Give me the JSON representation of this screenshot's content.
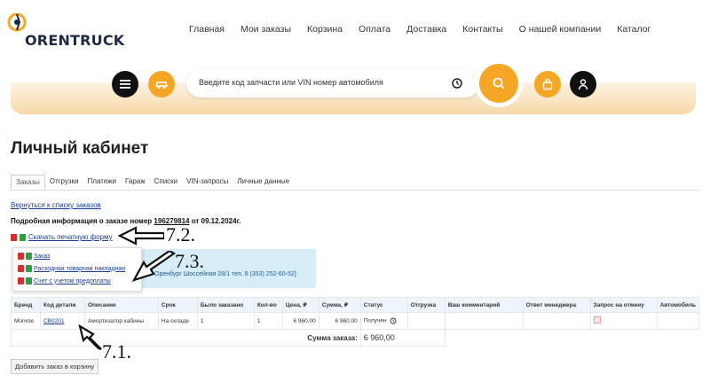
{
  "brand": {
    "logo_text": "ORENTRUCK"
  },
  "topnav": [
    "Главная",
    "Мои заказы",
    "Корзина",
    "Оплата",
    "Доставка",
    "Контакты",
    "О нашей компании",
    "Каталог"
  ],
  "search": {
    "placeholder": "Введите код запчасти или VIN номер автомобиля"
  },
  "page_title": "Личный кабинет",
  "tabs": [
    "Заказы",
    "Отгрузки",
    "Платежи",
    "Гараж",
    "Списки",
    "VIN-запросы",
    "Личные данные"
  ],
  "back_link": "Вернуться к списку заказов",
  "order_info": {
    "prefix": "Подробная информация о заказе номер",
    "number": "196279814",
    "suffix": "от 09.12.2024г."
  },
  "download_label": "Скачать печатную форму",
  "docs": [
    "Заказ",
    "Расходная товарная накладная",
    "Счет с учетом предоплаты"
  ],
  "store_info": "Оренбург Шоссейная 28/1 тел. 8 (353) 252-60-52]",
  "table": {
    "headers": [
      "Бренд",
      "Код детали",
      "Описание",
      "Срок",
      "Было заказано",
      "Кол-во",
      "Цена, ₽",
      "Сумма, ₽",
      "Статус",
      "Отгрузка",
      "Ваш комментарий",
      "Ответ менеджера",
      "Запрос на отмену",
      "Автомобиль"
    ],
    "rows": [
      {
        "brand": "Monroe",
        "code": "CB0201",
        "description": "Амортизатор кабины",
        "term": "На складе",
        "ordered": "1",
        "qty": "1",
        "price": "6 960,00",
        "sum": "6 960,00",
        "status": "Получен",
        "shipment": "",
        "comment": "",
        "manager": "",
        "auto": ""
      }
    ],
    "total_label": "Сумма заказа:",
    "total_value": "6 960,00"
  },
  "add_to_cart": "Добавить заказ в корзину",
  "annotations": [
    "7.1.",
    "7.2.",
    "7.3."
  ],
  "colors": {
    "accent": "#f5a623",
    "link": "#1a3d8f",
    "table_header": "#eef5fb",
    "info_box": "#d6ecf6"
  }
}
